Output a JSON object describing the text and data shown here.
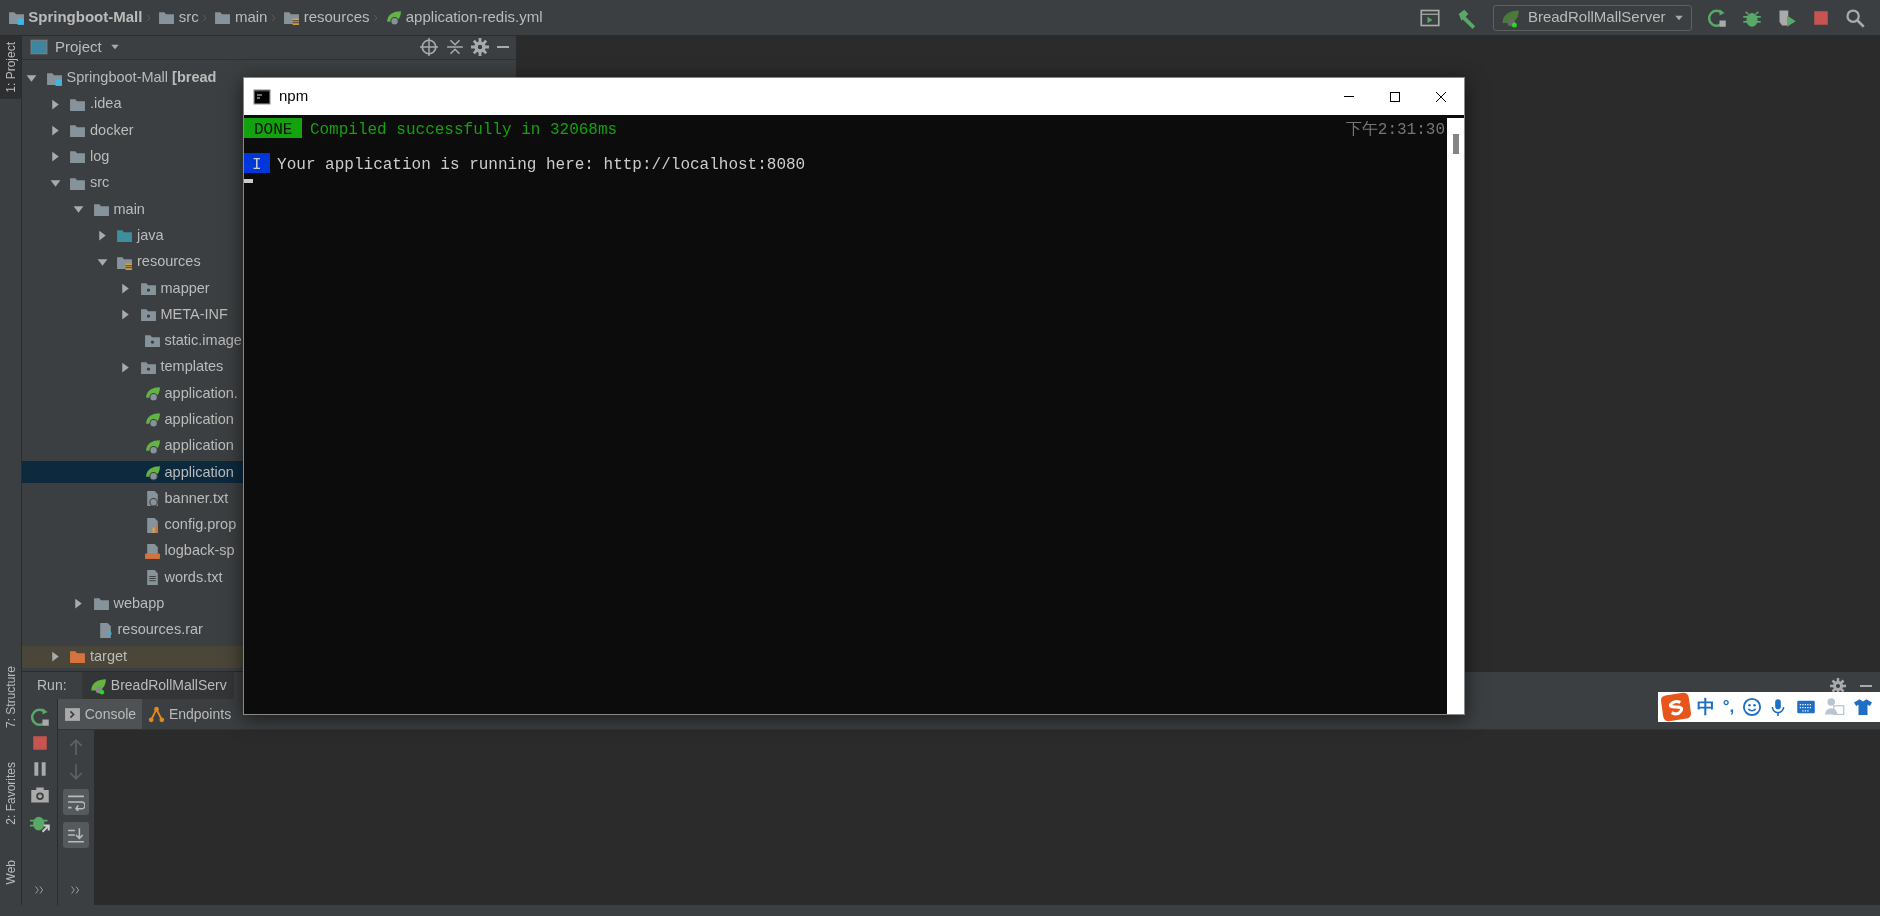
{
  "breadcrumb": [
    {
      "label": "Springboot-Mall",
      "kind": "project"
    },
    {
      "label": "src",
      "kind": "folder"
    },
    {
      "label": "main",
      "kind": "folder"
    },
    {
      "label": "resources",
      "kind": "resource-folder"
    },
    {
      "label": "application-redis.yml",
      "kind": "spring"
    }
  ],
  "toolbar": {
    "run_config": "BreadRollMallServer"
  },
  "left_strip": {
    "top": [
      {
        "label": "1: Project",
        "selected": true
      }
    ],
    "bottom": [
      {
        "label": "7: Structure",
        "selected": false
      },
      {
        "label": "2: Favorites",
        "selected": false
      },
      {
        "label": "Web",
        "selected": false
      }
    ]
  },
  "project_panel": {
    "title": "Project",
    "tree": [
      {
        "label": "Springboot-Mall **[bread**",
        "kind": "project",
        "expanded": true,
        "selected": false,
        "children": [
          {
            "label": ".idea",
            "kind": "folder",
            "expanded": false,
            "selected": false
          },
          {
            "label": "docker",
            "kind": "folder",
            "expanded": false,
            "selected": false
          },
          {
            "label": "log",
            "kind": "folder",
            "expanded": false,
            "selected": false
          },
          {
            "label": "src",
            "kind": "folder",
            "expanded": true,
            "selected": false,
            "children": [
              {
                "label": "main",
                "kind": "folder",
                "expanded": true,
                "selected": false,
                "children": [
                  {
                    "label": "java",
                    "kind": "source-folder",
                    "expanded": false,
                    "selected": false
                  },
                  {
                    "label": "resources",
                    "kind": "resource-folder",
                    "expanded": true,
                    "selected": false,
                    "children": [
                      {
                        "label": "mapper",
                        "kind": "package",
                        "expanded": false,
                        "selected": false
                      },
                      {
                        "label": "META-INF",
                        "kind": "package",
                        "expanded": false,
                        "selected": false
                      },
                      {
                        "label": "static.image",
                        "kind": "package",
                        "selected": false
                      },
                      {
                        "label": "templates",
                        "kind": "package",
                        "expanded": false,
                        "selected": false
                      },
                      {
                        "label": "application.",
                        "kind": "spring",
                        "selected": false
                      },
                      {
                        "label": "application",
                        "kind": "spring",
                        "selected": false
                      },
                      {
                        "label": "application",
                        "kind": "spring",
                        "selected": false
                      },
                      {
                        "label": "application",
                        "kind": "spring",
                        "selected": true
                      },
                      {
                        "label": "banner.txt",
                        "kind": "spring-text",
                        "selected": false
                      },
                      {
                        "label": "config.prop",
                        "kind": "properties",
                        "selected": false
                      },
                      {
                        "label": "logback-sp",
                        "kind": "xml",
                        "selected": false
                      },
                      {
                        "label": "words.txt",
                        "kind": "text",
                        "selected": false
                      }
                    ]
                  }
                ]
              },
              {
                "label": "webapp",
                "kind": "folder",
                "expanded": false,
                "selected": false
              },
              {
                "label": "resources.rar",
                "kind": "archive",
                "selected": false
              }
            ]
          },
          {
            "label": "target",
            "kind": "excluded-folder",
            "expanded": false,
            "selected": false
          }
        ]
      }
    ]
  },
  "run_panel": {
    "label": "Run:",
    "tab": "BreadRollMallServ",
    "tabs": [
      {
        "label": "Console",
        "selected": true
      },
      {
        "label": "Endpoints",
        "selected": false
      }
    ]
  },
  "terminal": {
    "title": "npm",
    "lines": [
      {
        "kind": "done",
        "badge": "DONE",
        "text": "Compiled successfully in 32068ms",
        "time": "下午2:31:30"
      },
      {
        "kind": "info",
        "badge": "I",
        "text": "Your application is running here: http://localhost:8080"
      }
    ]
  },
  "ime": {
    "mode": "中",
    "punct": "°,"
  }
}
